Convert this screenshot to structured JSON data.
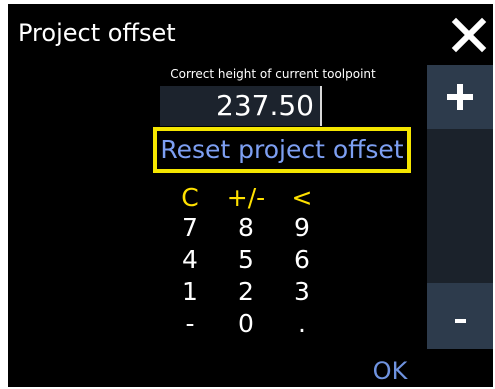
{
  "dialog": {
    "title": "Project offset",
    "close_icon": "close-icon"
  },
  "offset": {
    "subtitle": "Correct height of current toolpoint",
    "value": "237.50",
    "reset_label": "Reset project offset"
  },
  "keypad": {
    "row1": [
      "C",
      "+/-",
      "<"
    ],
    "row2": [
      "7",
      "8",
      "9"
    ],
    "row3": [
      "4",
      "5",
      "6"
    ],
    "row4": [
      "1",
      "2",
      "3"
    ],
    "row5": [
      "-",
      "0",
      "."
    ]
  },
  "side": {
    "plus_icon": "plus-icon",
    "minus_label": "-"
  },
  "footer": {
    "ok_label": "OK"
  },
  "colors": {
    "background": "#000000",
    "highlight_border": "#f5e600",
    "reset_text": "#7d9ff2",
    "function_keys": "#ffe100",
    "side_button": "#2d3b4c",
    "side_column": "#1b222b",
    "ok_text": "#6f93e0"
  }
}
